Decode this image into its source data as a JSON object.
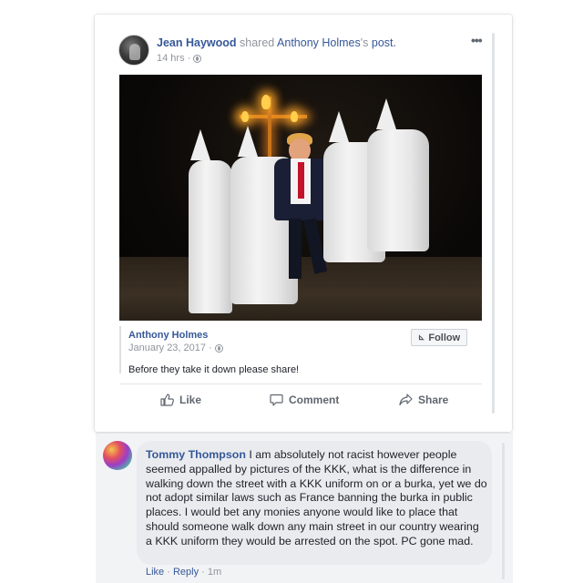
{
  "post": {
    "author": "Jean Haywood",
    "shared_word": "shared",
    "original_author_link": "Anthony Holmes",
    "possessive": "'s",
    "post_word": "post.",
    "time": "14 hrs",
    "meta_separator": "·",
    "more_icon": "more-horizontal-icon",
    "audience_icon": "globe-icon"
  },
  "shared": {
    "name": "Anthony Holmes",
    "date": "January 23, 2017",
    "separator": "·",
    "follow_label": "Follow",
    "text": "Before they take it down please share!"
  },
  "actions": {
    "like": "Like",
    "comment": "Comment",
    "share": "Share"
  },
  "comment": {
    "author": "Tommy Thompson",
    "text": "I am absolutely not racist however people seemed appalled by pictures of the KKK, what is the difference in walking down the street with a KKK uniform on or a burka, yet we do not adopt similar laws such as France banning the burka in public places. I would bet any monies anyone would like to place that should someone walk down any main street in our country wearing a KKK uniform they would be arrested on the spot. PC gone mad.",
    "like": "Like",
    "reply": "Reply",
    "separator": "·",
    "time": "1m"
  },
  "colors": {
    "link": "#365899",
    "meta": "#90949c",
    "text": "#1d2129",
    "bubble": "#e9ebee"
  }
}
